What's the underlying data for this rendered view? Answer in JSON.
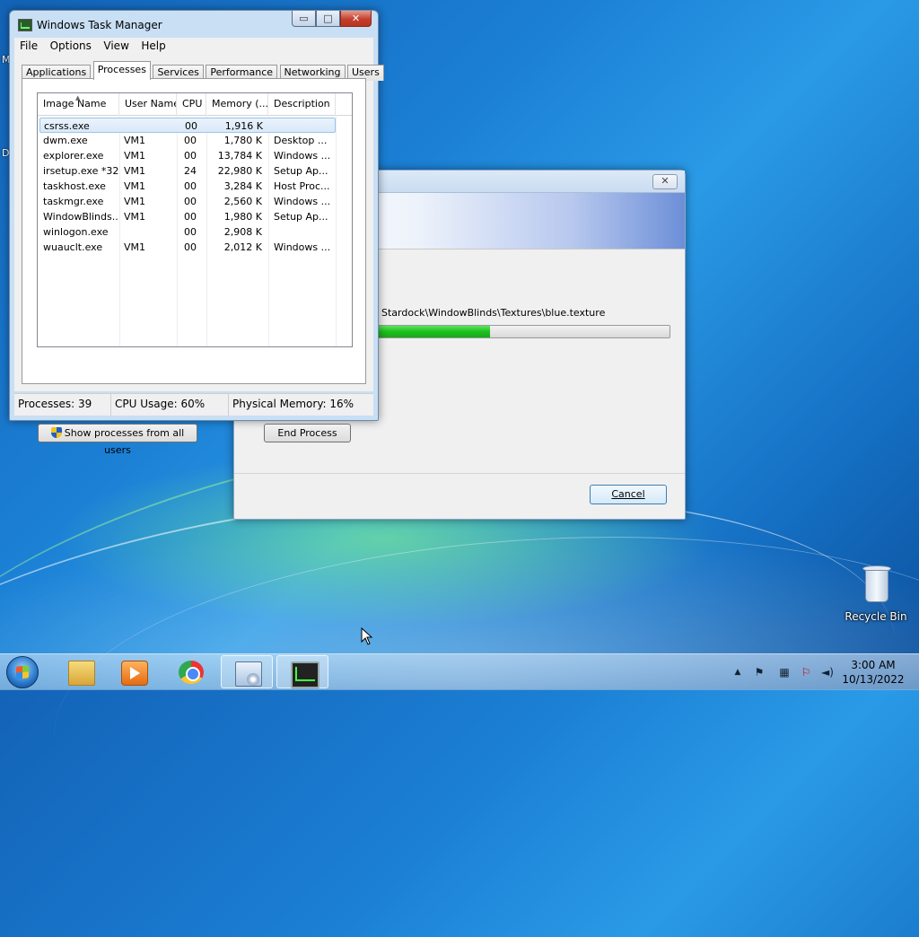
{
  "desktop": {
    "recycle_bin_label": "Recycle Bin",
    "left_edge_letters": [
      "M",
      "D"
    ]
  },
  "installer": {
    "close_glyph": "✕",
    "path_text": "Stardock\\WindowBlinds\\Textures\\blue.texture",
    "progress": 0.4,
    "cancel_label": "Cancel",
    "progress_color": "#22c422"
  },
  "taskmgr": {
    "title": "Windows Task Manager",
    "caption_buttons": {
      "minimize": "▭",
      "maximize": "□",
      "close": "✕"
    },
    "menu": [
      "File",
      "Options",
      "View",
      "Help"
    ],
    "tabs": [
      "Applications",
      "Processes",
      "Services",
      "Performance",
      "Networking",
      "Users"
    ],
    "active_tab": "Processes",
    "columns": [
      "Image Name",
      "User Name",
      "CPU",
      "Memory (...",
      "Description"
    ],
    "processes": [
      {
        "image": "csrss.exe",
        "user": "",
        "cpu": "00",
        "memory": "1,916 K",
        "description": ""
      },
      {
        "image": "dwm.exe",
        "user": "VM1",
        "cpu": "00",
        "memory": "1,780 K",
        "description": "Desktop ..."
      },
      {
        "image": "explorer.exe",
        "user": "VM1",
        "cpu": "00",
        "memory": "13,784 K",
        "description": "Windows ..."
      },
      {
        "image": "irsetup.exe *32",
        "user": "VM1",
        "cpu": "24",
        "memory": "22,980 K",
        "description": "Setup Ap..."
      },
      {
        "image": "taskhost.exe",
        "user": "VM1",
        "cpu": "00",
        "memory": "3,284 K",
        "description": "Host Proc..."
      },
      {
        "image": "taskmgr.exe",
        "user": "VM1",
        "cpu": "00",
        "memory": "2,560 K",
        "description": "Windows ..."
      },
      {
        "image": "WindowBlinds...",
        "user": "VM1",
        "cpu": "00",
        "memory": "1,980 K",
        "description": "Setup Ap..."
      },
      {
        "image": "winlogon.exe",
        "user": "",
        "cpu": "00",
        "memory": "2,908 K",
        "description": ""
      },
      {
        "image": "wuauclt.exe",
        "user": "VM1",
        "cpu": "00",
        "memory": "2,012 K",
        "description": "Windows ..."
      }
    ],
    "show_all_label": "Show processes from all users",
    "end_process_label": "End Process",
    "status": {
      "processes": "Processes: 39",
      "cpu": "CPU Usage: 60%",
      "memory": "Physical Memory: 16%"
    }
  },
  "taskbar": {
    "pinned": [
      {
        "name": "windows-explorer",
        "icon": "folder-icon"
      },
      {
        "name": "media-player",
        "icon": "media-player-icon"
      },
      {
        "name": "chrome",
        "icon": "chrome-icon"
      },
      {
        "name": "setup",
        "icon": "setup-icon",
        "active": true
      },
      {
        "name": "task-manager",
        "icon": "task-manager-icon",
        "active": true
      }
    ],
    "tray_icons": [
      "show-hidden-icons-arrow",
      "action-center-icon",
      "network-icon",
      "volume-icon"
    ],
    "clock_time": "3:00 AM",
    "clock_date": "10/13/2022"
  }
}
